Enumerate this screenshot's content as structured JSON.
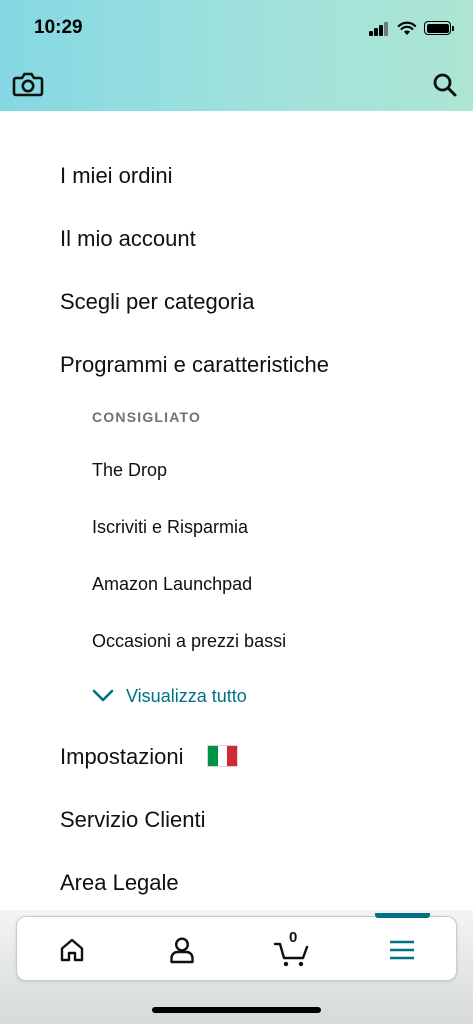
{
  "status_bar": {
    "time": "10:29"
  },
  "header": {
    "left_icon": "camera-icon",
    "right_icon": "search-icon",
    "gradient_colors": [
      "#84d8e3",
      "#ace5d2"
    ]
  },
  "menu": {
    "items": [
      {
        "label": "I miei ordini"
      },
      {
        "label": "Il mio account"
      },
      {
        "label": "Scegli per categoria"
      },
      {
        "label": "Programmi e caratteristiche"
      }
    ],
    "programs_section": {
      "heading": "CONSIGLIATO",
      "items": [
        {
          "label": "The Drop"
        },
        {
          "label": "Iscriviti e Risparmia"
        },
        {
          "label": "Amazon Launchpad"
        },
        {
          "label": "Occasioni a prezzi bassi"
        }
      ],
      "see_all": "Visualizza tutto"
    },
    "bottom_items": [
      {
        "label": "Impostazioni",
        "icon": "italy-flag-icon"
      },
      {
        "label": "Servizio Clienti"
      },
      {
        "label": "Area Legale"
      }
    ]
  },
  "bottom_nav": {
    "items": [
      {
        "name": "home",
        "icon": "home-icon"
      },
      {
        "name": "account",
        "icon": "person-icon"
      },
      {
        "name": "cart",
        "icon": "cart-icon",
        "count": "0"
      },
      {
        "name": "menu",
        "icon": "hamburger-menu-icon",
        "active": true
      }
    ],
    "accent_color": "#007185"
  }
}
